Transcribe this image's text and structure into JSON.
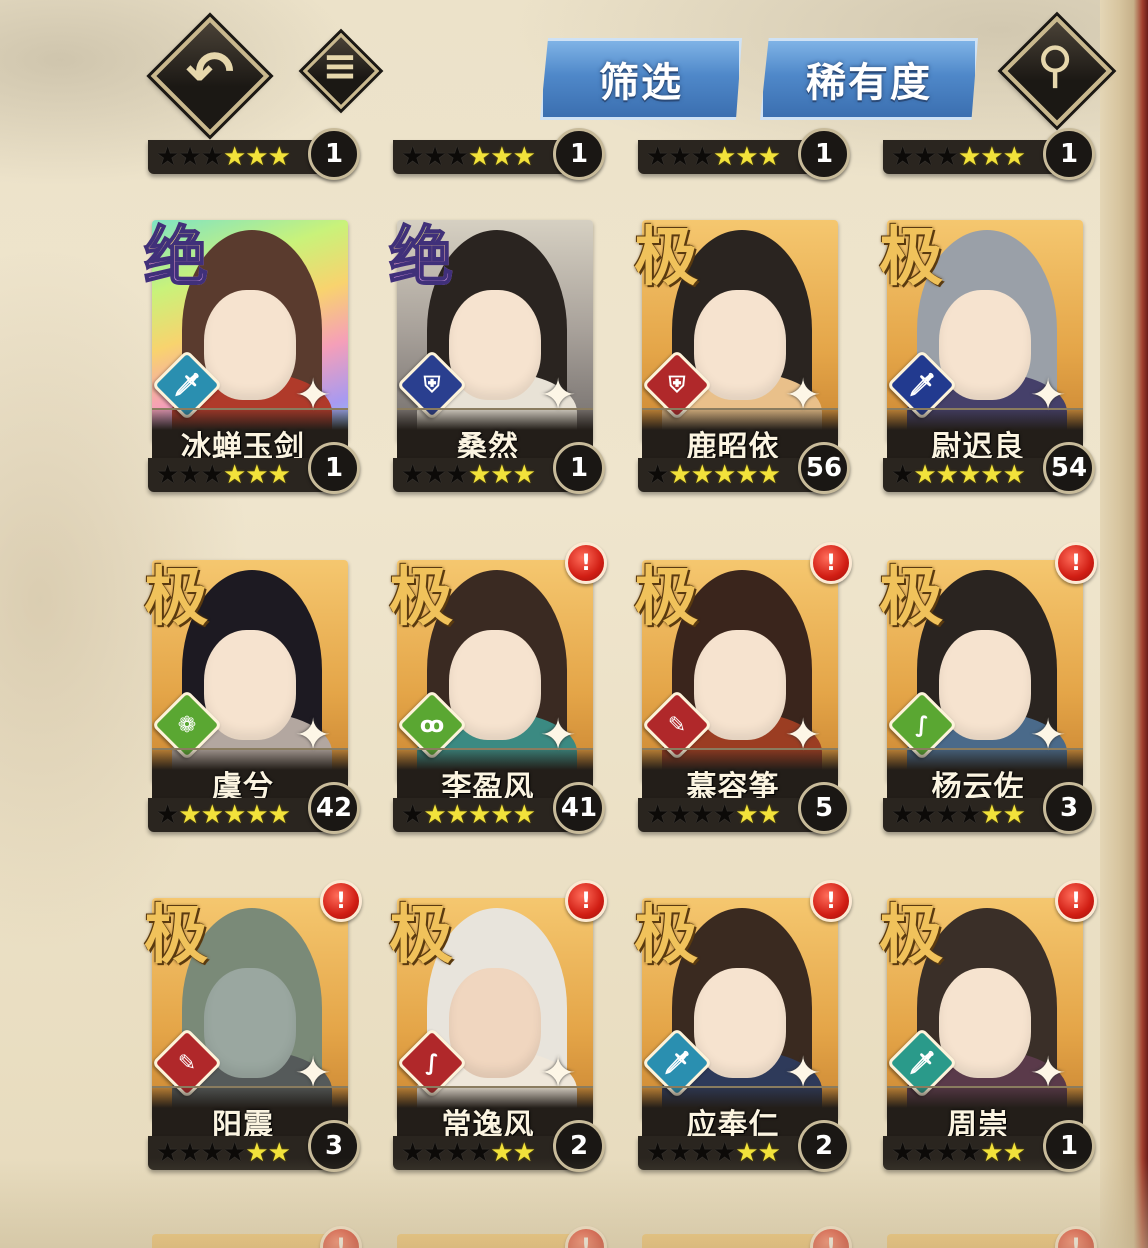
{
  "toolbar": {
    "back_icon": "back-arrow-icon",
    "menu_icon": "hamburger-menu-icon",
    "filter_label": "筛选",
    "rarity_label": "稀有度",
    "search_icon": "magnifier-icon"
  },
  "top_partial_row": [
    {
      "level": "1",
      "stars_on": 3,
      "stars_total": 6
    },
    {
      "level": "1",
      "stars_on": 3,
      "stars_total": 6
    },
    {
      "level": "1",
      "stars_on": 3,
      "stars_total": 6
    },
    {
      "level": "1",
      "stars_on": 3,
      "stars_total": 6
    }
  ],
  "heroes": [
    {
      "name": "冰蝉玉剑",
      "rank": "绝",
      "level": "1",
      "class_color": "#2a8fb0",
      "class_icon": "sword-icon",
      "stars_on": 3,
      "alert": false,
      "bg": "rainbow"
    },
    {
      "name": "桑然",
      "rank": "绝",
      "level": "1",
      "class_color": "#2a3f8f",
      "class_icon": "shield-icon",
      "stars_on": 3,
      "alert": false,
      "bg": "dark"
    },
    {
      "name": "鹿昭依",
      "rank": "极",
      "level": "56",
      "class_color": "#b0282a",
      "class_icon": "shield-icon",
      "stars_on": 5,
      "alert": false,
      "bg": "gold"
    },
    {
      "name": "尉迟良",
      "rank": "极",
      "level": "54",
      "class_color": "#223a8f",
      "class_icon": "sword-icon",
      "stars_on": 5,
      "alert": false,
      "bg": "gold"
    },
    {
      "name": "虞兮",
      "rank": "极",
      "level": "42",
      "class_color": "#5aa732",
      "class_icon": "gourd-icon",
      "stars_on": 5,
      "alert": false,
      "bg": "gold"
    },
    {
      "name": "李盈风",
      "rank": "极",
      "level": "41",
      "class_color": "#5aa732",
      "class_icon": "swirl-icon",
      "stars_on": 5,
      "alert": true,
      "bg": "gold"
    },
    {
      "name": "慕容筝",
      "rank": "极",
      "level": "5",
      "class_color": "#b0282a",
      "class_icon": "scroll-icon",
      "stars_on": 2,
      "alert": true,
      "bg": "gold"
    },
    {
      "name": "杨云佐",
      "rank": "极",
      "level": "3",
      "class_color": "#5aa732",
      "class_icon": "snake-icon",
      "stars_on": 2,
      "alert": true,
      "bg": "gold"
    },
    {
      "name": "阳震",
      "rank": "极",
      "level": "3",
      "class_color": "#b0282a",
      "class_icon": "scroll-icon",
      "stars_on": 2,
      "alert": true,
      "bg": "gold"
    },
    {
      "name": "常逸风",
      "rank": "极",
      "level": "2",
      "class_color": "#b0282a",
      "class_icon": "snake-icon",
      "stars_on": 2,
      "alert": true,
      "bg": "gold"
    },
    {
      "name": "应奉仁",
      "rank": "极",
      "level": "2",
      "class_color": "#2a8fb0",
      "class_icon": "sword-icon",
      "stars_on": 2,
      "alert": true,
      "bg": "gold"
    },
    {
      "name": "周崇",
      "rank": "极",
      "level": "1",
      "class_color": "#2a9a8a",
      "class_icon": "sword-icon",
      "stars_on": 2,
      "alert": true,
      "bg": "gold"
    }
  ],
  "colors": {
    "parchment": "#e9dcc0",
    "tab_blue": "#4f88c9",
    "star_on": "#f2e23b",
    "alert_red": "#d11e14",
    "rank_gold": "#f0c25b"
  }
}
